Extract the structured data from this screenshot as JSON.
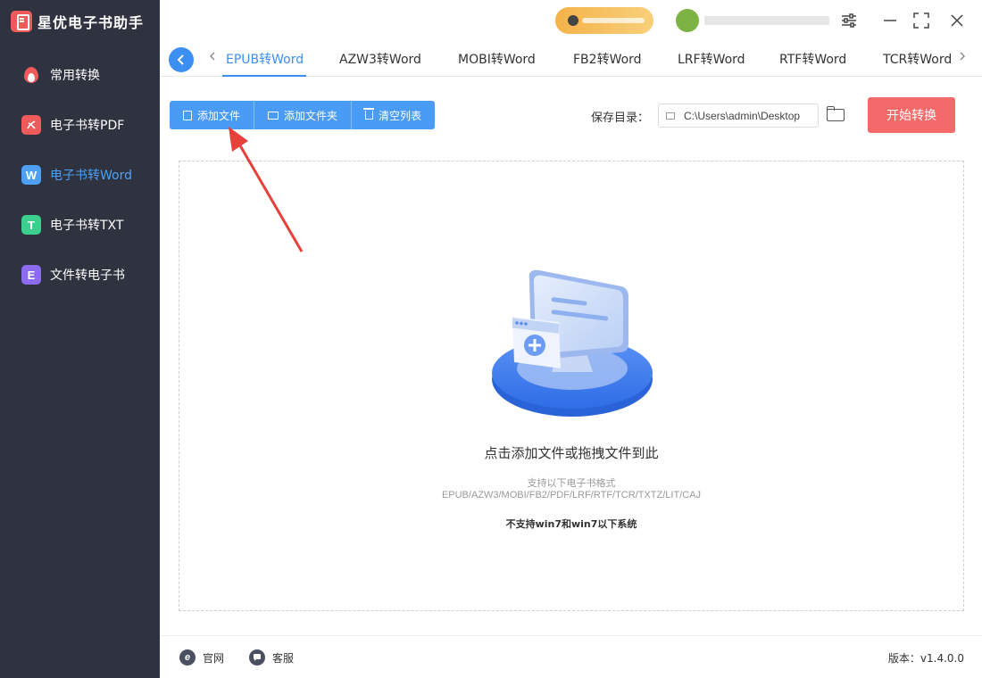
{
  "app": {
    "title": "星优电子书助手"
  },
  "sidebar": {
    "items": [
      {
        "label": "常用转换",
        "icon": "fire-icon"
      },
      {
        "label": "电子书转PDF",
        "icon": "pdf-icon",
        "icon_text": ""
      },
      {
        "label": "电子书转Word",
        "icon": "word-icon",
        "icon_text": "W",
        "active": true
      },
      {
        "label": "电子书转TXT",
        "icon": "txt-icon",
        "icon_text": "T"
      },
      {
        "label": "文件转电子书",
        "icon": "ebook-icon",
        "icon_text": "E"
      }
    ]
  },
  "tabs": {
    "items": [
      "EPUB转Word",
      "AZW3转Word",
      "MOBI转Word",
      "FB2转Word",
      "LRF转Word",
      "RTF转Word",
      "TCR转Word"
    ],
    "active_index": 0
  },
  "toolbar": {
    "add_file": "添加文件",
    "add_folder": "添加文件夹",
    "clear_list": "清空列表"
  },
  "save": {
    "label": "保存目录：",
    "path": "C:\\Users\\admin\\Desktop"
  },
  "start_button": "开始转换",
  "dropzone": {
    "title": "点击添加文件或拖拽文件到此",
    "subtitle": "支持以下电子书格式",
    "formats": "EPUB/AZW3/MOBI/FB2/PDF/LRF/RTF/TCR/TXTZ/LIT/CAJ",
    "warning": "不支持win7和win7以下系统"
  },
  "footer": {
    "site": "官网",
    "service": "客服",
    "version": "版本：v1.4.0.0"
  },
  "colors": {
    "sidebar_bg": "#2f3340",
    "accent": "#3b8ff2",
    "start": "#f46a6a",
    "arrow": "#e8403a"
  }
}
